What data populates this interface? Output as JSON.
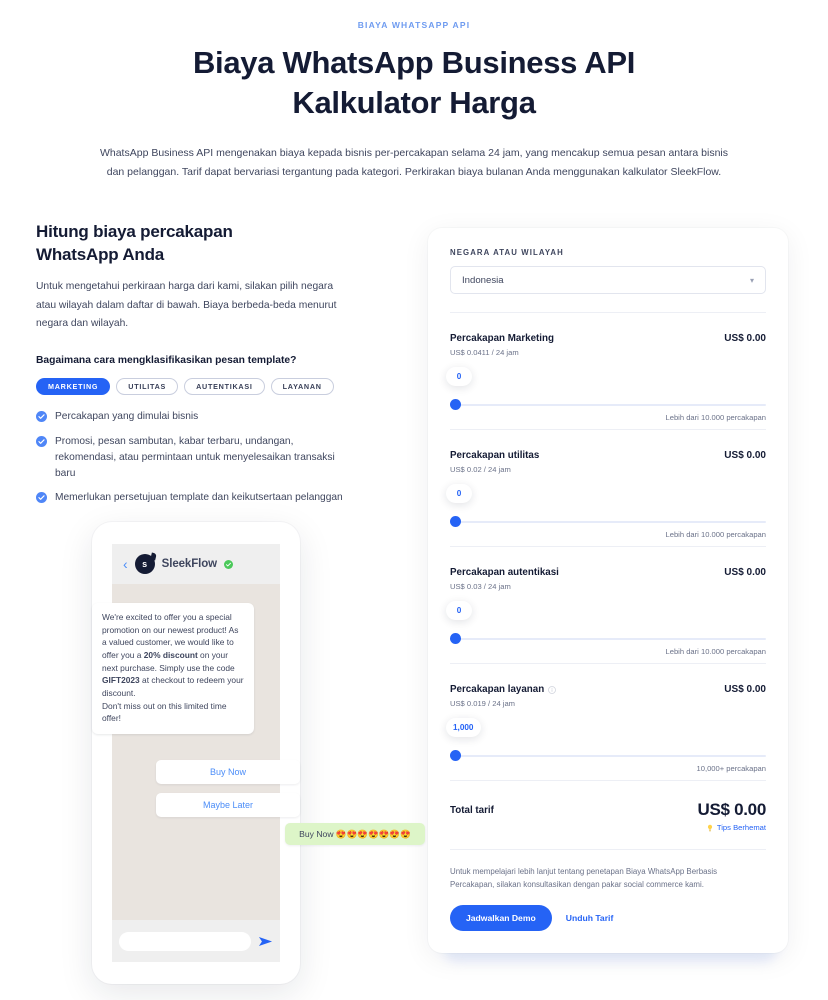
{
  "hero": {
    "eyebrow": "BIAYA WHATSAPP API",
    "title_line1": "Biaya WhatsApp Business API",
    "title_line2": "Kalkulator Harga",
    "subtitle": "WhatsApp Business API mengenakan biaya kepada bisnis per-percakapan selama 24 jam, yang mencakup semua pesan antara bisnis dan pelanggan. Tarif dapat bervariasi tergantung pada kategori. Perkirakan biaya bulanan Anda menggunakan kalkulator SleekFlow."
  },
  "left": {
    "heading_line1": "Hitung biaya percakapan",
    "heading_line2": "WhatsApp Anda",
    "paragraph": "Untuk mengetahui perkiraan harga dari kami, silakan pilih negara atau wilayah dalam daftar di bawah. Biaya berbeda-beda menurut negara dan wilayah.",
    "question": "Bagaimana cara mengklasifikasikan pesan template?",
    "tabs": [
      {
        "label": "MARKETING",
        "active": true
      },
      {
        "label": "UTILITAS",
        "active": false
      },
      {
        "label": "AUTENTIKASI",
        "active": false
      },
      {
        "label": "LAYANAN",
        "active": false
      }
    ],
    "bullets": [
      "Percakapan yang dimulai bisnis",
      "Promosi, pesan sambutan, kabar terbaru, undangan, rekomendasi, atau permintaan untuk menyelesaikan transaksi baru",
      "Memerlukan persetujuan template dan keikutsertaan pelanggan"
    ]
  },
  "phone": {
    "contact_name": "SleekFlow",
    "avatar_letter": "s",
    "message": "We're excited to offer you a special promotion on our newest product! As a valued customer, we would like to offer you a 20% discount on your next purchase. Simply use the code GIFT2023 at checkout to redeem your discount.\nDon't miss out on this limited time offer!",
    "message_bold_1": "20% discount",
    "message_bold_2": "GIFT2023",
    "reply_buttons": [
      "Buy Now",
      "Maybe Later"
    ],
    "outgoing_message": "Buy Now 😍😍😍😍😍😍😍"
  },
  "calculator": {
    "country_label": "NEGARA ATAU WILAYAH",
    "country_value": "Indonesia",
    "rates": [
      {
        "name": "Percakapan Marketing",
        "unit": "US$ 0.0411 / 24 jam",
        "price": "US$ 0.00",
        "value": "0",
        "max_label": "Lebih dari 10.000 percakapan",
        "has_info": false,
        "thumb_pct": 0
      },
      {
        "name": "Percakapan utilitas",
        "unit": "US$ 0.02 / 24 jam",
        "price": "US$ 0.00",
        "value": "0",
        "max_label": "Lebih dari 10.000 percakapan",
        "has_info": false,
        "thumb_pct": 0
      },
      {
        "name": "Percakapan autentikasi",
        "unit": "US$ 0.03 / 24 jam",
        "price": "US$ 0.00",
        "value": "0",
        "max_label": "Lebih dari 10.000 percakapan",
        "has_info": false,
        "thumb_pct": 0
      },
      {
        "name": "Percakapan layanan",
        "unit": "US$ 0.019 / 24 jam",
        "price": "US$ 0.00",
        "value": "1,000",
        "max_label": "10,000+ percakapan",
        "has_info": true,
        "thumb_pct": 0
      }
    ],
    "total_label": "Total tarif",
    "total_amount": "US$ 0.00",
    "tips_label": "Tips Berhemat",
    "footer_text": "Untuk mempelajari lebih lanjut tentang penetapan Biaya WhatsApp Berbasis Percakapan, silakan konsultasikan dengan pakar social commerce kami.",
    "primary_button": "Jadwalkan Demo",
    "link_button": "Unduh Tarif"
  },
  "colors": {
    "accent": "#2563f5",
    "ink": "#141b34",
    "muted": "#6b7289",
    "eyebrow": "#6e9bf0",
    "verified": "#4bc95a",
    "bubble_out": "#ddf5c8"
  }
}
